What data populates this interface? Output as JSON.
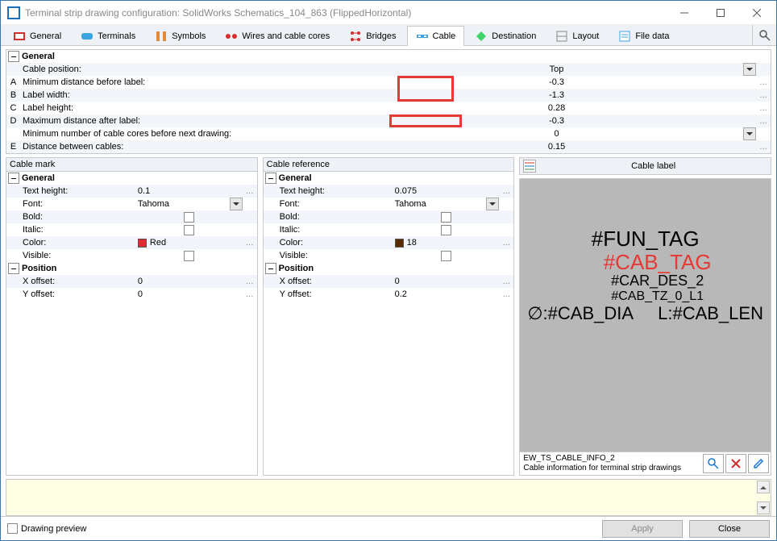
{
  "window": {
    "title": "Terminal strip drawing configuration: SolidWorks Schematics_104_863 (FlippedHorizontal)"
  },
  "tabs": [
    {
      "label": "General"
    },
    {
      "label": "Terminals"
    },
    {
      "label": "Symbols"
    },
    {
      "label": "Wires and cable cores"
    },
    {
      "label": "Bridges"
    },
    {
      "label": "Cable"
    },
    {
      "label": "Destination"
    },
    {
      "label": "Layout"
    },
    {
      "label": "File data"
    }
  ],
  "main_grid": {
    "section": "General",
    "rows": [
      {
        "idx": "",
        "label": "Cable position:",
        "value": "Top",
        "suffix": "",
        "dropdown": true
      },
      {
        "idx": "A",
        "label": "Minimum distance before label:",
        "value": "-0.3",
        "suffix": "..."
      },
      {
        "idx": "B",
        "label": "Label width:",
        "value": "-1.3",
        "suffix": "..."
      },
      {
        "idx": "C",
        "label": "Label height:",
        "value": "0.28",
        "suffix": "..."
      },
      {
        "idx": "D",
        "label": "Maximum distance after label:",
        "value": "-0.3",
        "suffix": "..."
      },
      {
        "idx": "",
        "label": "Minimum number of cable cores before next drawing:",
        "value": "0",
        "suffix": "",
        "dropdown": true
      },
      {
        "idx": "E",
        "label": "Distance between cables:",
        "value": "0.15",
        "suffix": "..."
      }
    ]
  },
  "cable_mark": {
    "title": "Cable mark",
    "sections": [
      {
        "name": "General",
        "rows": [
          {
            "label": "Text height:",
            "value": "0.1",
            "suffix": "..."
          },
          {
            "label": "Font:",
            "value": "Tahoma",
            "dropdown": true
          },
          {
            "label": "Bold:",
            "checkbox": true
          },
          {
            "label": "Italic:",
            "checkbox": true
          },
          {
            "label": "Color:",
            "color": "#d32f2f",
            "color_name": "Red",
            "suffix": "..."
          },
          {
            "label": "Visible:",
            "checkbox": true
          }
        ]
      },
      {
        "name": "Position",
        "rows": [
          {
            "label": "X offset:",
            "value": "0",
            "suffix": "..."
          },
          {
            "label": "Y offset:",
            "value": "0",
            "suffix": "..."
          }
        ]
      }
    ]
  },
  "cable_reference": {
    "title": "Cable reference",
    "sections": [
      {
        "name": "General",
        "rows": [
          {
            "label": "Text height:",
            "value": "0.075",
            "suffix": "..."
          },
          {
            "label": "Font:",
            "value": "Tahoma",
            "dropdown": true
          },
          {
            "label": "Bold:",
            "checkbox": true
          },
          {
            "label": "Italic:",
            "checkbox": true
          },
          {
            "label": "Color:",
            "color": "#5a2a00",
            "color_name": "18",
            "suffix": "..."
          },
          {
            "label": "Visible:",
            "checkbox": true
          }
        ]
      },
      {
        "name": "Position",
        "rows": [
          {
            "label": "X offset:",
            "value": "0",
            "suffix": "..."
          },
          {
            "label": "Y offset:",
            "value": "0.2",
            "suffix": "..."
          }
        ]
      }
    ]
  },
  "cable_label": {
    "header": "Cable label",
    "tags": {
      "fun": "#FUN_TAG",
      "cab": "#CAB_TAG",
      "car": "#CAR_DES_2",
      "tz": "#CAB_TZ_0_L1",
      "dia_prefix": "∅:#CAB_DIA",
      "len": "L:#CAB_LEN"
    },
    "footer_name": "EW_TS_CABLE_INFO_2",
    "footer_desc": "Cable information for terminal strip drawings"
  },
  "footer": {
    "drawing_preview": "Drawing preview",
    "apply": "Apply",
    "close": "Close"
  }
}
